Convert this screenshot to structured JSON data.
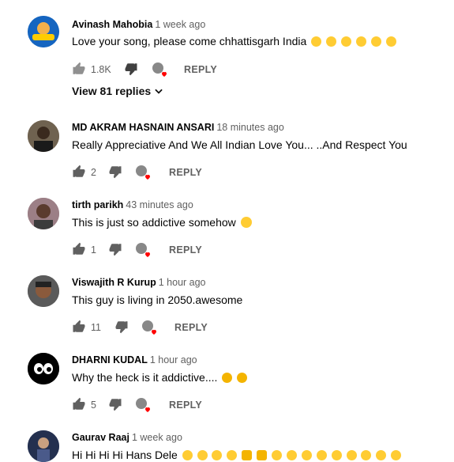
{
  "comments": [
    {
      "author": "Avinash Mahobia",
      "time": "1 week ago",
      "text": "Love your song, please come chhattisgarh India",
      "emoji_count": 6,
      "emoji": "face-savoring-food",
      "likes": "1.8K",
      "reply_label": "REPLY",
      "view_replies": "View 81 replies",
      "avatar_color": "#1565c0"
    },
    {
      "author": "MD AKRAM HASNAIN ANSARI",
      "time": "18 minutes ago",
      "text": "Really Appreciative And We All Indian Love You... ..And Respect You",
      "likes": "2",
      "reply_label": "REPLY",
      "avatar_color": "#6d5a44"
    },
    {
      "author": "tirth parikh",
      "time": "43 minutes ago",
      "text": "This is just so addictive somehow",
      "emoji": "heart-eyes-face",
      "likes": "1",
      "reply_label": "REPLY",
      "avatar_color": "#8a6f73"
    },
    {
      "author": "Viswajith R Kurup",
      "time": "1 hour ago",
      "text": "This guy is living in 2050.awesome",
      "likes": "11",
      "reply_label": "REPLY",
      "avatar_color": "#4e4e4e"
    },
    {
      "author": "DHARNI KUDAL",
      "time": "1 hour ago",
      "text": "Why the heck is it addictive....",
      "emoji": "grinning-cat-face",
      "likes": "5",
      "reply_label": "REPLY",
      "avatar_color": "#000000"
    },
    {
      "author": "Gaurav Raaj",
      "time": "1 week ago",
      "text": "Hi Hi Hi Hi Hans Dele",
      "emoji": "tears-of-joy-face",
      "likes": "",
      "reply_label": "",
      "avatar_color": "#2c3e6b"
    }
  ],
  "colors": {
    "text": "#030303",
    "secondary": "#606060",
    "heart": "#ff0000",
    "emoji_yellow": "#ffcc33"
  },
  "icons": [
    "thumb-up-icon",
    "thumb-down-icon",
    "creator-heart-icon",
    "chevron-down-icon"
  ]
}
